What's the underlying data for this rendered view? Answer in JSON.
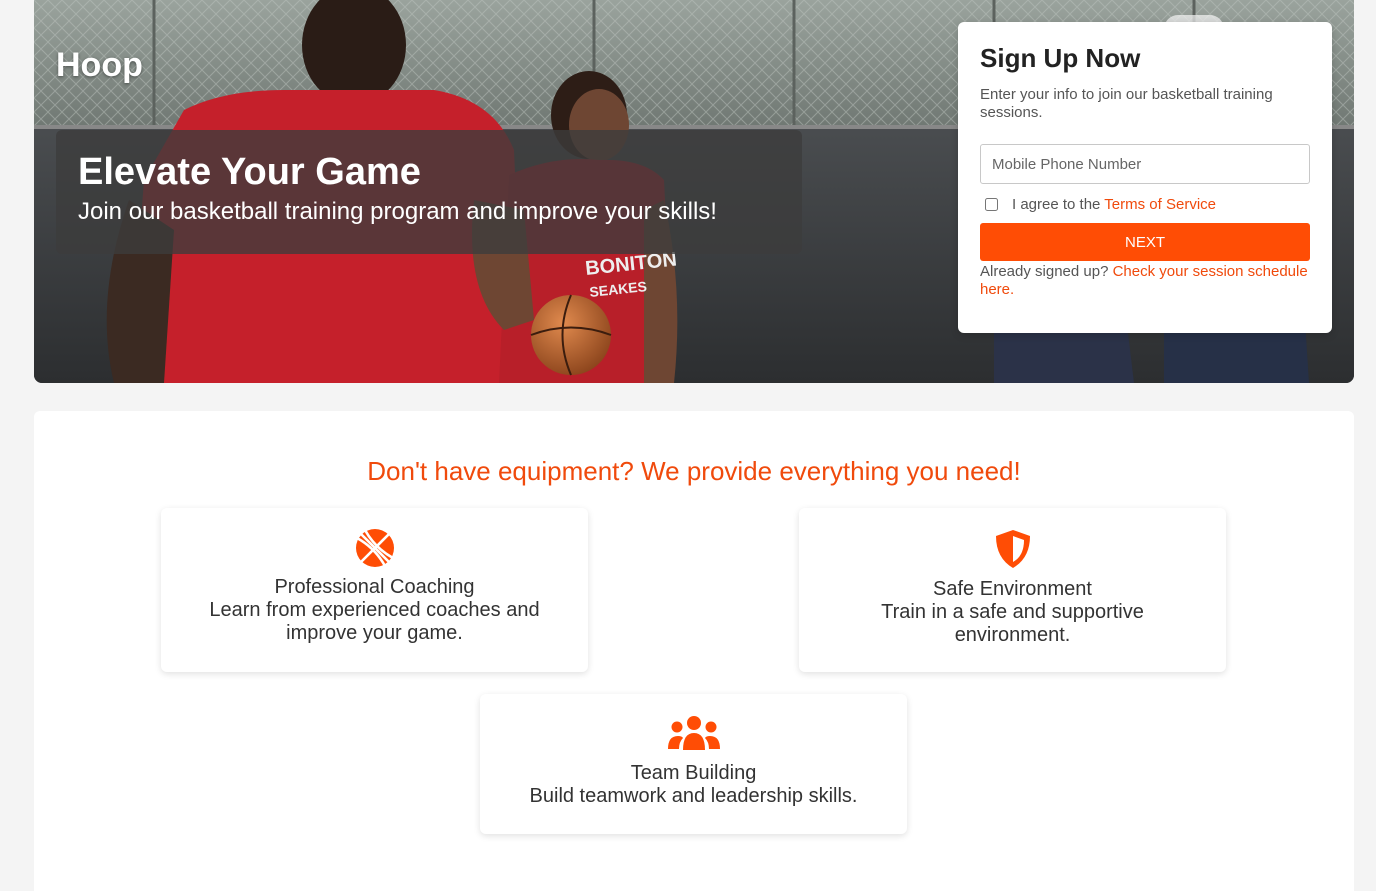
{
  "brand": "Hoop",
  "hero": {
    "title": "Elevate Your Game",
    "subtitle": "Join our basketball training program and improve your skills!"
  },
  "signup": {
    "title": "Sign Up Now",
    "description": "Enter your info to join our basketball training sessions.",
    "phone_placeholder": "Mobile Phone Number",
    "agree_text": "I agree to the ",
    "terms_link": "Terms of Service",
    "next_label": "NEXT",
    "already_text": "Already signed up? ",
    "schedule_link": "Check your session schedule here."
  },
  "features": {
    "heading": "Don't have equipment? We provide everything you need!",
    "cards": [
      {
        "icon": "basketball-icon",
        "title": "Professional Coaching",
        "text": "Learn from experienced coaches and improve your game."
      },
      {
        "icon": "shield-icon",
        "title": "Safe Environment",
        "text": "Train in a safe and supportive environment."
      },
      {
        "icon": "users-icon",
        "title": "Team Building",
        "text": "Build teamwork and leadership skills."
      }
    ]
  },
  "colors": {
    "accent": "#ff4d05",
    "link": "#f04a0c",
    "page_bg": "#f4f4f4"
  }
}
